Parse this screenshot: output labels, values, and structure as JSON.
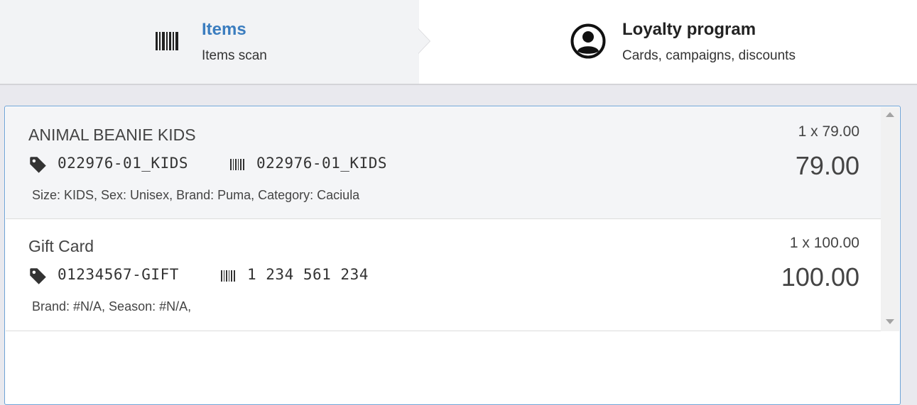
{
  "tabs": [
    {
      "title": "Items",
      "subtitle": "Items scan",
      "icon": "barcode-icon",
      "active": true,
      "title_color": "#3b7dbf"
    },
    {
      "title": "Loyalty program",
      "subtitle": "Cards, campaigns, discounts",
      "icon": "user-circle-icon",
      "active": false,
      "title_color": "#222222"
    }
  ],
  "items": [
    {
      "name": "ANIMAL BEANIE KIDS",
      "sku": "022976-01_KIDS",
      "barcode": "022976-01_KIDS",
      "attributes": "Size: KIDS, Sex: Unisex, Brand: Puma, Category: Caciula",
      "quantity_price": "1 x 79.00",
      "total": "79.00"
    },
    {
      "name": "Gift Card",
      "sku": "01234567-GIFT",
      "barcode": "1 234 561 234",
      "attributes": "Brand: #N/A, Season: #N/A,",
      "quantity_price": "1 x 100.00",
      "total": "100.00"
    }
  ],
  "colors": {
    "accent": "#3b7dbf",
    "panel_border": "#6ea3d6",
    "selected_row": "#f4f5f7"
  }
}
